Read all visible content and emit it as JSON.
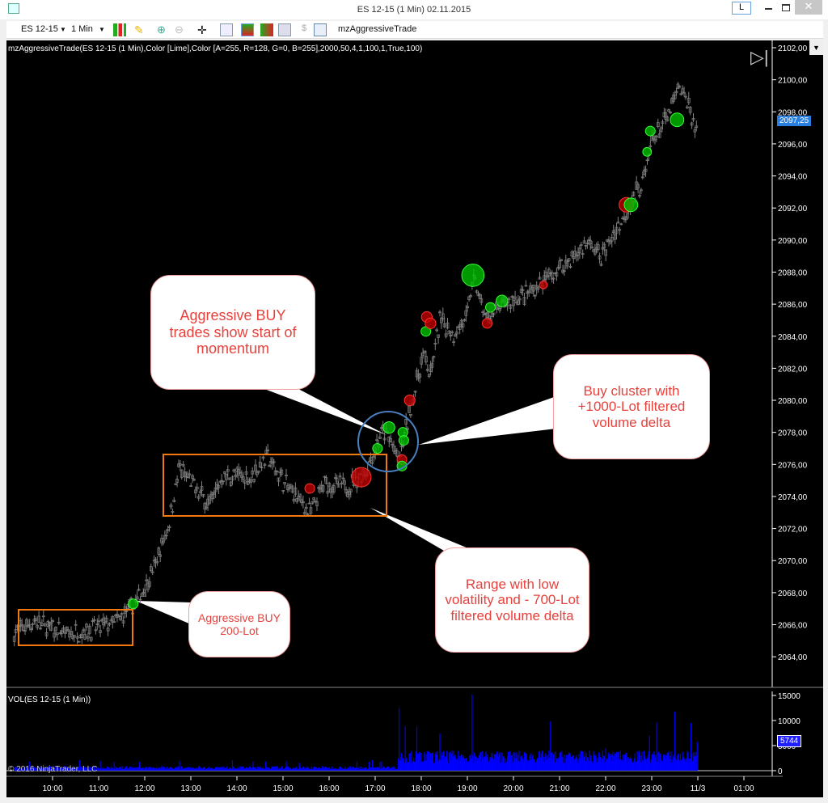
{
  "window": {
    "title": "ES 12-15 (1 Min)  02.11.2015",
    "link_button": "L"
  },
  "toolbar": {
    "instrument": "ES 12-15",
    "interval": "1 Min",
    "strategy_label": "mzAggressiveTrade",
    "icons": [
      "bar-type-icon",
      "pencil-draw-icon",
      "zoom-in-icon",
      "zoom-out-icon",
      "crosshair-icon",
      "search-icon",
      "chart-trader-icon",
      "strategies-icon",
      "indicators-icon",
      "dollar-icon",
      "properties-icon"
    ]
  },
  "chart": {
    "indicator_label": "mzAggressiveTrade(ES 12-15 (1 Min),Color [Lime],Color [A=255, R=128, G=0, B=255],2000,50,4,1,100,1,True,100)",
    "volume_label": "VOL(ES 12-15 (1 Min))",
    "copyright": "© 2016 NinjaTrader, LLC",
    "last_price": "2097,25",
    "last_volume": "5744",
    "price_ticks": [
      "2102,00",
      "2100,00",
      "2098,00",
      "2096,00",
      "2094,00",
      "2092,00",
      "2090,00",
      "2088,00",
      "2086,00",
      "2084,00",
      "2082,00",
      "2080,00",
      "2078,00",
      "2076,00",
      "2074,00",
      "2072,00",
      "2070,00",
      "2068,00",
      "2066,00",
      "2064,00"
    ],
    "volume_ticks": [
      "15000",
      "10000",
      "5000",
      "0"
    ],
    "time_ticks": [
      "10:00",
      "11:00",
      "12:00",
      "13:00",
      "14:00",
      "15:00",
      "16:00",
      "17:00",
      "18:00",
      "19:00",
      "20:00",
      "21:00",
      "22:00",
      "23:00",
      "11/3",
      "01:00"
    ],
    "colors": {
      "background": "#000000",
      "bars": "#808080",
      "buy": "#00c000",
      "sell": "#c00000",
      "volume": "#0000ff",
      "range_box": "#ff8000",
      "cluster_circle": "#4a7fc0",
      "callout_text": "#e8413c"
    }
  },
  "annotations": [
    {
      "text": "Aggressive BUY trades show start of momentum"
    },
    {
      "text": "Buy cluster with +1000-Lot filtered volume delta"
    },
    {
      "text": "Range with low volatility and - 700-Lot filtered volume delta"
    },
    {
      "text": "Aggressive BUY 200-Lot"
    }
  ],
  "chart_data": {
    "type": "candlestick",
    "price_path": [
      [
        9.17,
        2065.5
      ],
      [
        9.6,
        2066.2
      ],
      [
        10.3,
        2065.4
      ],
      [
        11,
        2065.8
      ],
      [
        11.45,
        2066.3
      ],
      [
        11.8,
        2067.3
      ],
      [
        12.2,
        2069.5
      ],
      [
        12.5,
        2072
      ],
      [
        12.75,
        2075.8
      ],
      [
        13.1,
        2074.5
      ],
      [
        13.4,
        2073.5
      ],
      [
        13.7,
        2075.3
      ],
      [
        14.3,
        2075.2
      ],
      [
        14.65,
        2076.5
      ],
      [
        15.1,
        2074.6
      ],
      [
        15.6,
        2073
      ],
      [
        15.9,
        2074.8
      ],
      [
        16.4,
        2074.6
      ],
      [
        16.8,
        2075.6
      ],
      [
        17.15,
        2078
      ],
      [
        17.35,
        2077.5
      ],
      [
        17.5,
        2076
      ],
      [
        17.65,
        2078
      ],
      [
        17.85,
        2080.5
      ],
      [
        18.05,
        2083
      ],
      [
        18.2,
        2081.5
      ],
      [
        18.4,
        2085
      ],
      [
        18.7,
        2084.2
      ],
      [
        19,
        2085.2
      ],
      [
        19.12,
        2087.8
      ],
      [
        19.4,
        2085
      ],
      [
        19.8,
        2086
      ],
      [
        20.3,
        2086.6
      ],
      [
        20.7,
        2087.5
      ],
      [
        21.2,
        2088.7
      ],
      [
        21.6,
        2089.8
      ],
      [
        21.9,
        2089
      ],
      [
        22.3,
        2091
      ],
      [
        22.6,
        2092.6
      ],
      [
        22.85,
        2094
      ],
      [
        23.0,
        2096.2
      ],
      [
        23.3,
        2097.4
      ],
      [
        23.6,
        2099.5
      ],
      [
        23.8,
        2098.5
      ],
      [
        23.99,
        2096.5
      ]
    ],
    "trades": [
      {
        "t": 11.75,
        "p": 2067.3,
        "side": "buy",
        "size": 1
      },
      {
        "t": 15.58,
        "p": 2074.5,
        "side": "sell",
        "size": 1
      },
      {
        "t": 16.7,
        "p": 2075.2,
        "side": "sell",
        "size": 2
      },
      {
        "t": 17.05,
        "p": 2077,
        "side": "buy",
        "size": 1
      },
      {
        "t": 17.3,
        "p": 2078.3,
        "side": "buy",
        "size": 1.2
      },
      {
        "t": 17.6,
        "p": 2078,
        "side": "buy",
        "size": 1
      },
      {
        "t": 17.62,
        "p": 2077.5,
        "side": "buy",
        "size": 1
      },
      {
        "t": 17.58,
        "p": 2076.3,
        "side": "sell",
        "size": 1
      },
      {
        "t": 17.58,
        "p": 2075.9,
        "side": "buy",
        "size": 1
      },
      {
        "t": 17.75,
        "p": 2080,
        "side": "sell",
        "size": 1.1
      },
      {
        "t": 18.1,
        "p": 2084.3,
        "side": "buy",
        "size": 1
      },
      {
        "t": 18.12,
        "p": 2085.2,
        "side": "sell",
        "size": 1.1
      },
      {
        "t": 18.2,
        "p": 2084.8,
        "side": "sell",
        "size": 1.1
      },
      {
        "t": 19.12,
        "p": 2087.8,
        "side": "buy",
        "size": 2.3
      },
      {
        "t": 19.43,
        "p": 2084.8,
        "side": "sell",
        "size": 1
      },
      {
        "t": 19.5,
        "p": 2085.8,
        "side": "buy",
        "size": 1
      },
      {
        "t": 19.75,
        "p": 2086.2,
        "side": "buy",
        "size": 1.2
      },
      {
        "t": 20.65,
        "p": 2087.2,
        "side": "sell",
        "size": 0.8
      },
      {
        "t": 22.45,
        "p": 2092.2,
        "side": "sell",
        "size": 1.5
      },
      {
        "t": 22.55,
        "p": 2092.2,
        "side": "buy",
        "size": 1.4
      },
      {
        "t": 22.9,
        "p": 2095.5,
        "side": "buy",
        "size": 0.9
      },
      {
        "t": 22.97,
        "p": 2096.8,
        "side": "buy",
        "size": 1
      },
      {
        "t": 23.55,
        "p": 2097.5,
        "side": "buy",
        "size": 1.4
      }
    ],
    "volume_spikes": [
      [
        17.52,
        12500
      ],
      [
        17.65,
        8800
      ],
      [
        17.9,
        8800
      ],
      [
        18.4,
        7400
      ],
      [
        19.1,
        15200
      ],
      [
        20.8,
        9800
      ],
      [
        22.0,
        4500
      ],
      [
        22.95,
        7000
      ],
      [
        23.1,
        9600
      ],
      [
        23.5,
        11800
      ],
      [
        23.85,
        9500
      ],
      [
        23.99,
        5744
      ]
    ],
    "price_range": [
      2063,
      2102.5
    ],
    "volume_range": [
      0,
      15000
    ],
    "time_range": [
      "09:10",
      "01:30"
    ],
    "grid": false
  }
}
